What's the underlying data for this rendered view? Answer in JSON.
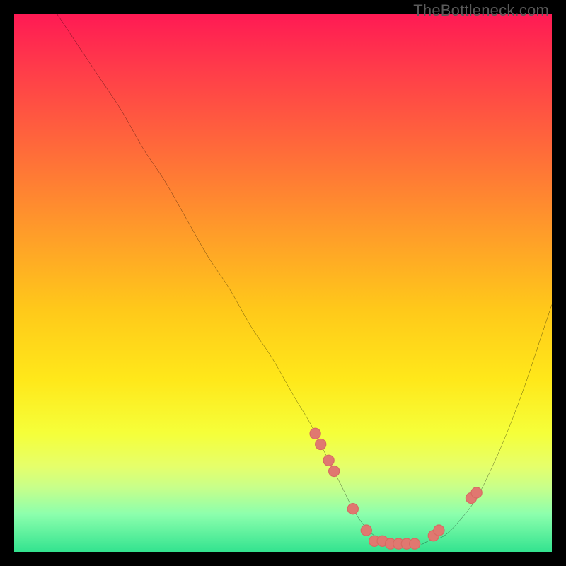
{
  "watermark": "TheBottleneck.com",
  "colors": {
    "frame": "#000000",
    "curve": "#000000",
    "dot_fill": "#e07870",
    "dot_stroke": "#d76a62"
  },
  "chart_data": {
    "type": "line",
    "title": "",
    "xlabel": "",
    "ylabel": "",
    "xlim": [
      0,
      100
    ],
    "ylim": [
      0,
      100
    ],
    "x": [
      8,
      12,
      16,
      20,
      24,
      28,
      32,
      36,
      40,
      44,
      48,
      52,
      55,
      58,
      61,
      63,
      65,
      67,
      69,
      71,
      73,
      75,
      77,
      80,
      83,
      86,
      89,
      92,
      95,
      98,
      100
    ],
    "y": [
      100,
      94,
      88,
      82,
      75,
      69,
      62,
      55,
      49,
      42,
      36,
      29,
      24,
      18,
      12,
      8,
      5,
      3,
      2,
      1,
      1,
      1,
      2,
      3,
      6,
      10,
      16,
      23,
      31,
      40,
      46
    ],
    "dots": {
      "x": [
        56,
        57,
        58.5,
        59.5,
        63,
        65.5,
        67,
        68.5,
        70,
        71.5,
        73,
        74.5,
        78,
        79,
        85,
        86
      ],
      "y": [
        22,
        20,
        17,
        15,
        8,
        4,
        2,
        2,
        1.5,
        1.5,
        1.5,
        1.5,
        3,
        4,
        10,
        11
      ]
    }
  }
}
